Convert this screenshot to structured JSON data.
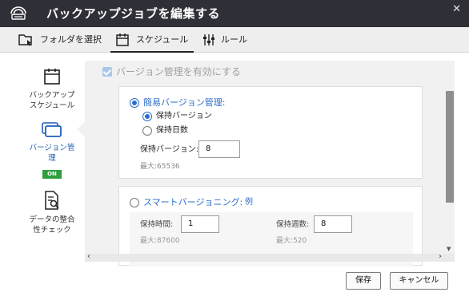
{
  "window": {
    "title": "バックアップジョブを編集する",
    "close_glyph": "✕"
  },
  "tabs": [
    {
      "label": "フォルダを選択",
      "icon": "folder-select-icon"
    },
    {
      "label": "スケジュール",
      "icon": "calendar-icon"
    },
    {
      "label": "ルール",
      "icon": "sliders-icon"
    }
  ],
  "active_tab": "スケジュール",
  "sidebar": {
    "items": [
      {
        "label": "バックアップ\nスケジュール",
        "icon": "calendar-icon"
      },
      {
        "label": "バージョン管\n理",
        "icon": "versions-icon",
        "badge": "ON"
      },
      {
        "label": "データの整合\n性チェック",
        "icon": "document-search-icon"
      }
    ],
    "selected": "バージョン管理"
  },
  "versioning": {
    "enable_label": "バージョン管理を有効にする",
    "enable_checked": true,
    "simple": {
      "title": "簡易バージョン管理:",
      "selected": true,
      "options": [
        {
          "label": "保持バージョン",
          "selected": true
        },
        {
          "label": "保持日数",
          "selected": false
        }
      ],
      "keep_versions_label": "保持バージョン:",
      "keep_versions_value": "8",
      "max_text": "最大:65536"
    },
    "smart": {
      "title": "スマートバージョニング:",
      "example_link": "例",
      "selected": false,
      "hours_label": "保持時間:",
      "hours_value": "1",
      "hours_max": "最大:87600",
      "weeks_label": "保持週数:",
      "weeks_value": "8",
      "weeks_max": "最大:520"
    }
  },
  "scroll": {
    "left_arrow": "‹",
    "right_arrow": "›",
    "down_arrow": "▼"
  },
  "footer": {
    "save_label": "保存",
    "cancel_label": "キャンセル"
  },
  "colors": {
    "titlebar": "#2f2f37",
    "accent": "#2a6ecb",
    "badge_green": "#2e9e3e"
  }
}
